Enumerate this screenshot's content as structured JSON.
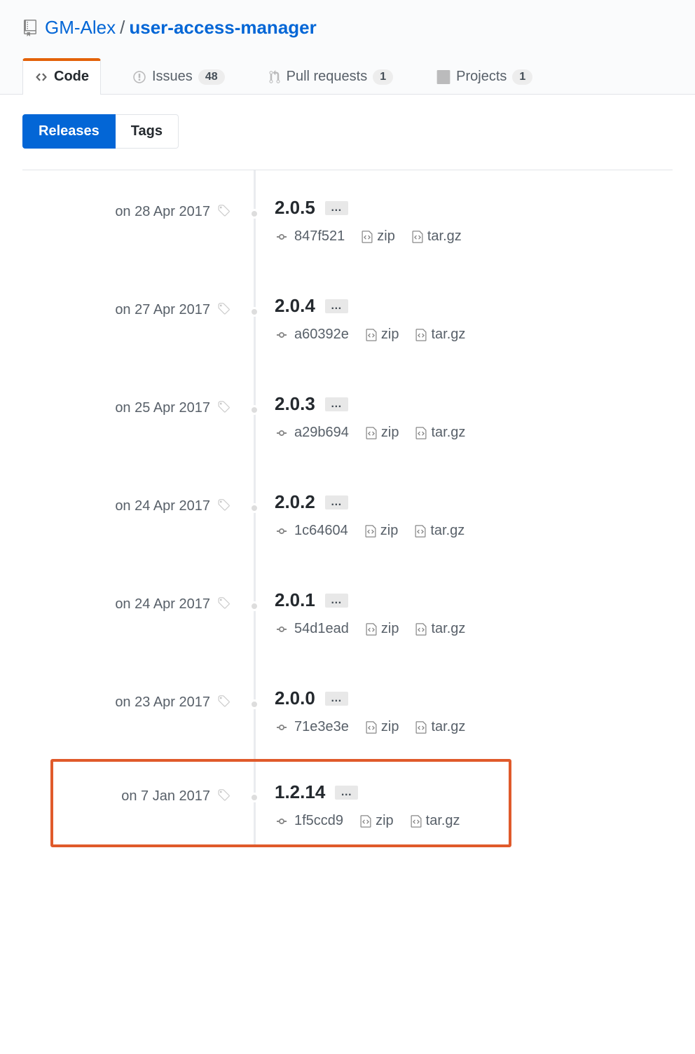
{
  "breadcrumb": {
    "owner": "GM-Alex",
    "repo": "user-access-manager"
  },
  "tabs": [
    {
      "label": "Code",
      "count": null,
      "active": true,
      "icon": "code"
    },
    {
      "label": "Issues",
      "count": "48",
      "active": false,
      "icon": "issue"
    },
    {
      "label": "Pull requests",
      "count": "1",
      "active": false,
      "icon": "pr"
    },
    {
      "label": "Projects",
      "count": "1",
      "active": false,
      "icon": "project"
    }
  ],
  "subnav": {
    "releases": "Releases",
    "tags": "Tags"
  },
  "ellipsis": "…",
  "zip_label": "zip",
  "targz_label": "tar.gz",
  "releases": [
    {
      "date": "on 28 Apr 2017",
      "version": "2.0.5",
      "commit": "847f521",
      "highlighted": false
    },
    {
      "date": "on 27 Apr 2017",
      "version": "2.0.4",
      "commit": "a60392e",
      "highlighted": false
    },
    {
      "date": "on 25 Apr 2017",
      "version": "2.0.3",
      "commit": "a29b694",
      "highlighted": false
    },
    {
      "date": "on 24 Apr 2017",
      "version": "2.0.2",
      "commit": "1c64604",
      "highlighted": false
    },
    {
      "date": "on 24 Apr 2017",
      "version": "2.0.1",
      "commit": "54d1ead",
      "highlighted": false
    },
    {
      "date": "on 23 Apr 2017",
      "version": "2.0.0",
      "commit": "71e3e3e",
      "highlighted": false
    },
    {
      "date": "on 7 Jan 2017",
      "version": "1.2.14",
      "commit": "1f5ccd9",
      "highlighted": true
    }
  ]
}
